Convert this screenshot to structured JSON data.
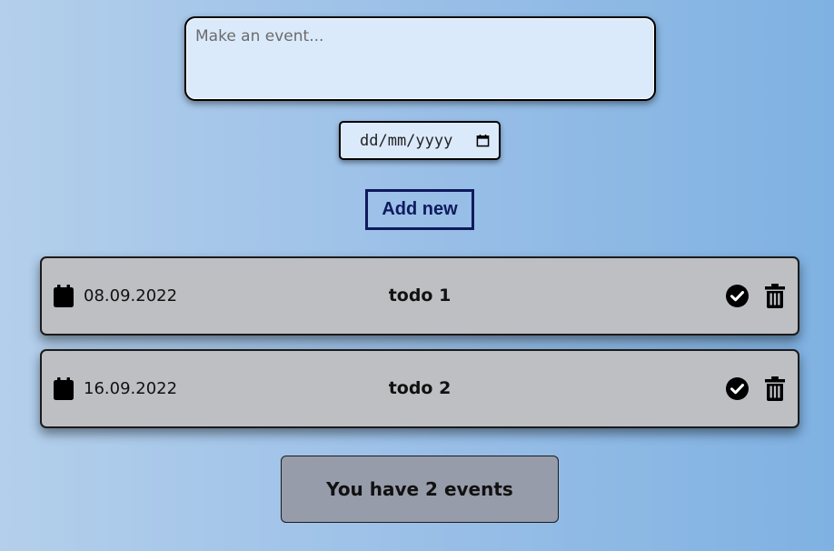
{
  "form": {
    "event_placeholder": "Make an event...",
    "date_placeholder": "dd/mm/yyyy",
    "add_label": "Add new"
  },
  "events": [
    {
      "date": "08.09.2022",
      "title": "todo 1",
      "date_icon": "calendar-icon",
      "done_icon": "check-circle-icon",
      "delete_icon": "trash-icon"
    },
    {
      "date": "16.09.2022",
      "title": "todo 2",
      "date_icon": "calendar-icon",
      "done_icon": "check-circle-icon",
      "delete_icon": "trash-icon"
    }
  ],
  "footer": {
    "counter_text": "You have 2 events"
  },
  "colors": {
    "accent": "#0f1a5c",
    "card_background": "#bebfc3",
    "counter_background": "#979caa",
    "input_background": "#dbeafb"
  }
}
